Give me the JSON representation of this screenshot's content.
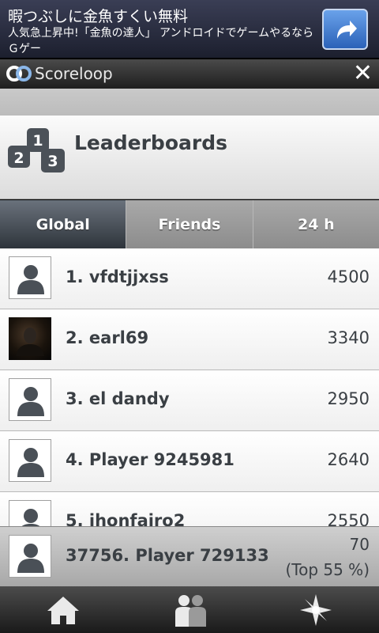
{
  "ad": {
    "title": "暇つぶしに金魚すくい無料",
    "body": "人気急上昇中!「金魚の達人」 アンドロイドでゲームやるならＧゲー",
    "action_icon": "share-arrow-icon"
  },
  "app_bar": {
    "brand": "Scoreloop",
    "close_label": "✕"
  },
  "header": {
    "title": "Leaderboards",
    "icon": "podium-icon"
  },
  "tabs": [
    {
      "label": "Global",
      "active": true
    },
    {
      "label": "Friends",
      "active": false
    },
    {
      "label": "24 h",
      "active": false
    }
  ],
  "leaderboard": [
    {
      "name": "1. vfdtjjxss",
      "score": "4500",
      "avatar": "default"
    },
    {
      "name": "2. earl69",
      "score": "3340",
      "avatar": "photo"
    },
    {
      "name": "3. el dandy",
      "score": "2950",
      "avatar": "default"
    },
    {
      "name": "4. Player 9245981",
      "score": "2640",
      "avatar": "default"
    },
    {
      "name": "5. jhonfairo2",
      "score": "2550",
      "avatar": "default"
    }
  ],
  "my_rank": {
    "name": "37756. Player 729133",
    "score": "70",
    "percentile": "(Top 55 %)"
  },
  "bottom_nav": [
    {
      "icon": "home-icon"
    },
    {
      "icon": "friends-icon"
    },
    {
      "icon": "star-burst-icon"
    }
  ]
}
